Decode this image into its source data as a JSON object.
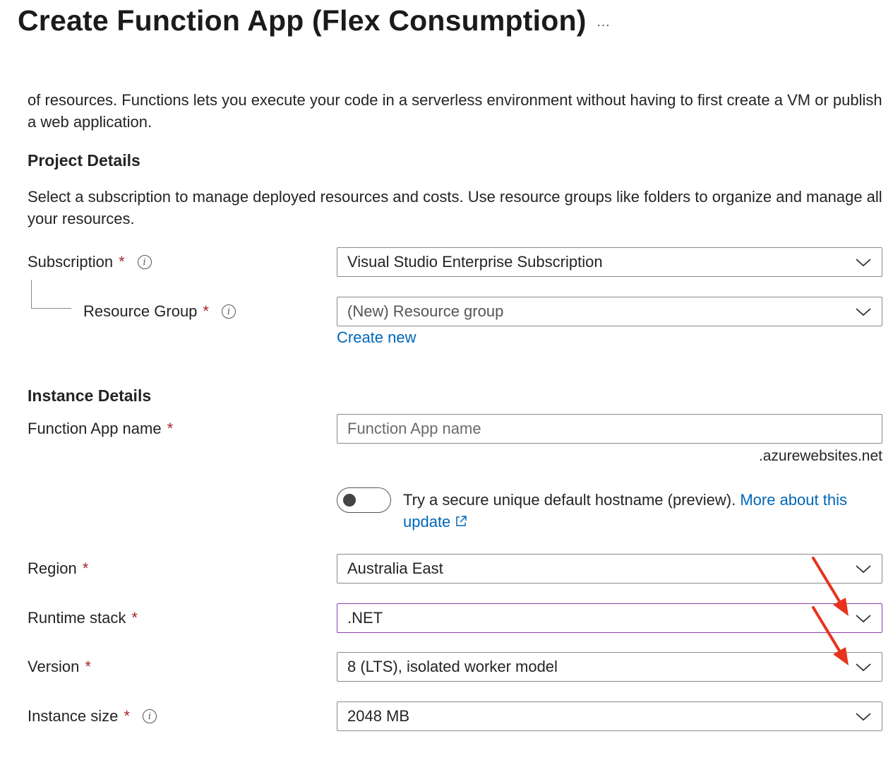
{
  "header": {
    "title": "Create Function App (Flex Consumption)",
    "more_label": "…"
  },
  "intro": {
    "text": "of resources. Functions lets you execute your code in a serverless environment without having to first create a VM or publish a web application."
  },
  "project_details": {
    "heading": "Project Details",
    "description": "Select a subscription to manage deployed resources and costs. Use resource groups like folders to organize and manage all your resources.",
    "subscription": {
      "label": "Subscription",
      "required": "*",
      "value": "Visual Studio Enterprise Subscription"
    },
    "resource_group": {
      "label": "Resource Group",
      "required": "*",
      "value": "(New) Resource group",
      "create_new": "Create new"
    }
  },
  "instance_details": {
    "heading": "Instance Details",
    "function_app_name": {
      "label": "Function App name",
      "required": "*",
      "placeholder": "Function App name",
      "value": "",
      "suffix": ".azurewebsites.net"
    },
    "secure_hostname": {
      "enabled": false,
      "text": "Try a secure unique default hostname (preview).",
      "link": "More about this update"
    },
    "region": {
      "label": "Region",
      "required": "*",
      "value": "Australia East"
    },
    "runtime_stack": {
      "label": "Runtime stack",
      "required": "*",
      "value": ".NET"
    },
    "version": {
      "label": "Version",
      "required": "*",
      "value": "8 (LTS), isolated worker model"
    },
    "instance_size": {
      "label": "Instance size",
      "required": "*",
      "value": "2048 MB"
    }
  },
  "icons": {
    "info": "info-icon",
    "chevron": "chevron-down-icon",
    "external": "external-link-icon"
  },
  "colors": {
    "link": "#0067b8",
    "required": "#a4262c",
    "focus_border": "#8a3fb0",
    "annotation_arrow": "#e8321e"
  }
}
